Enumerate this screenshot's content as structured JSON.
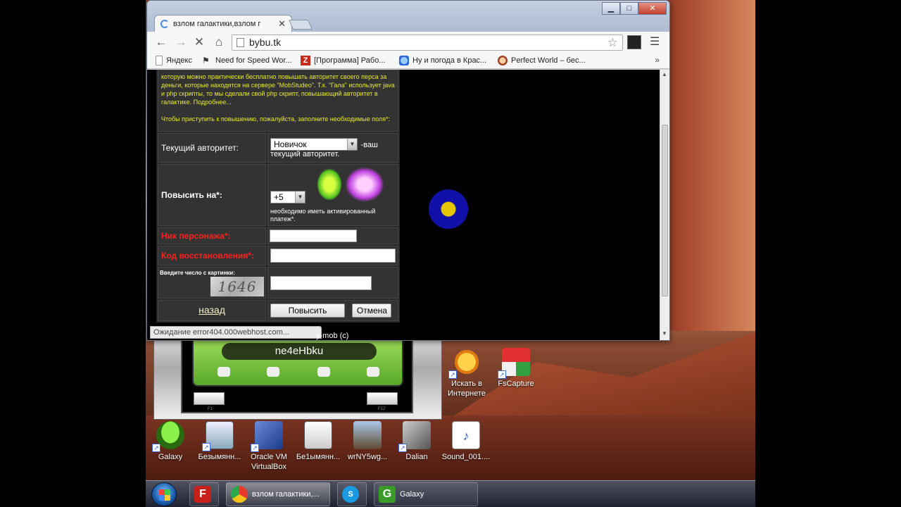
{
  "browser": {
    "tab_title": "взлом галактики,взлом г",
    "url": "bybu.tk",
    "bookmarks": [
      "Яндекс",
      "Need for Speed Wor...",
      "[Программа] Рабо...",
      "Ну и погода в Крас...",
      "Perfect World – бес..."
    ],
    "status": "Ожидание error404.000webhost.com..."
  },
  "page": {
    "intro1": "которую можно практически бесплатно повышать авторитет своего перса за деньги, которые находятся на сервере \"MobStudeo\". Т.к. \"Гала\" использует java и php скрипты, то мы сделали свой php скрипт, повышающий авторитет в галактике. Подробнее...",
    "intro2": "Чтобы приступить к повышению, пожалуйста, заполните необходимые поля*:",
    "current_label": "Текущий авторитет:",
    "current_value": "Новичок",
    "current_suffix": "-ваш",
    "current_suffix2": "текущий авторитет.",
    "raise_label": "Повысить на*:",
    "raise_value": "+5",
    "raise_note": "необходимо иметь активированный платеж*.",
    "nick_label": "Ник персонажа*:",
    "code_label": "Код восстановления*:",
    "captcha_label": "Введите число с картинки:",
    "captcha_text": "1646",
    "back": "назад",
    "submit": "Повысить",
    "cancel": "Отмена",
    "footer": "y-mob (c)"
  },
  "miniapp": {
    "title": "ne4eHbku",
    "key_left": "F1",
    "key_right": "F12"
  },
  "desktop_icons": [
    {
      "label": "Искать в Интернете"
    },
    {
      "label": "FsCapture"
    },
    {
      "label": "Galaxy"
    },
    {
      "label": "Безымянн..."
    },
    {
      "label": "Oracle VM VirtualBox"
    },
    {
      "label": "Бе1ымянн..."
    },
    {
      "label": "wrNY5wg..."
    },
    {
      "label": "Dalian"
    },
    {
      "label": "Sound_001...."
    }
  ],
  "taskbar": {
    "chrome_label": "взлом галактики,...",
    "galaxy_label": "Galaxy"
  }
}
